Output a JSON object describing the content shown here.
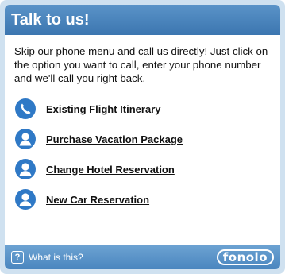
{
  "header": {
    "title": "Talk to us!"
  },
  "intro": {
    "text": "Skip our phone menu and call us directly! Just click on the option you want to call, enter your phone number and we'll call you right back."
  },
  "options": [
    {
      "label": "Existing Flight Itinerary",
      "icon": "phone-icon"
    },
    {
      "label": "Purchase Vacation Package",
      "icon": "person-icon"
    },
    {
      "label": "Change Hotel Reservation",
      "icon": "person-icon"
    },
    {
      "label": "New Car Reservation",
      "icon": "person-icon"
    }
  ],
  "footer": {
    "help_symbol": "?",
    "help_label": "What is this?",
    "brand": "fonolo"
  },
  "colors": {
    "header_bg": "#3c76b0",
    "icon_blue": "#2f79c6",
    "footer_bg": "#4a86bf"
  }
}
